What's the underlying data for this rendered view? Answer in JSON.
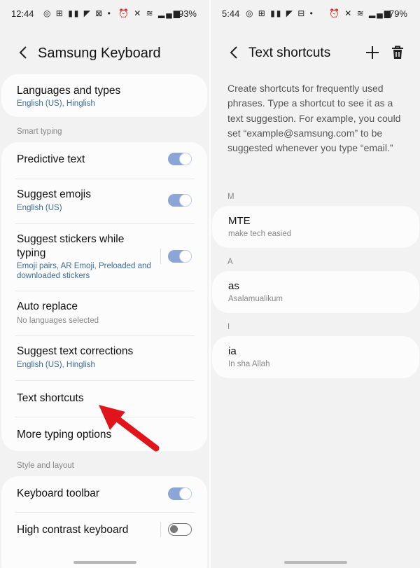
{
  "left": {
    "status": {
      "time": "12:44",
      "battery": "93%"
    },
    "header": {
      "title": "Samsung Keyboard"
    },
    "languages": {
      "label": "Languages and types",
      "value": "English (US), Hinglish"
    },
    "smart_typing": {
      "section_label": "Smart typing",
      "items": [
        {
          "label": "Predictive text",
          "toggle": true
        },
        {
          "label": "Suggest emojis",
          "sub": "English (US)",
          "toggle": true
        },
        {
          "label": "Suggest stickers while typing",
          "sub": "Emoji pairs, AR Emoji, Preloaded and downloaded stickers",
          "toggle": true
        },
        {
          "label": "Auto replace",
          "sub": "No languages selected"
        },
        {
          "label": "Suggest text corrections",
          "sub": "English (US), Hinglish"
        },
        {
          "label": "Text shortcuts"
        },
        {
          "label": "More typing options"
        }
      ]
    },
    "style_layout": {
      "section_label": "Style and layout",
      "items": [
        {
          "label": "Keyboard toolbar",
          "toggle": true
        },
        {
          "label": "High contrast keyboard",
          "toggle": false
        }
      ]
    }
  },
  "right": {
    "status": {
      "time": "5:44",
      "battery": "79%"
    },
    "header": {
      "title": "Text shortcuts"
    },
    "description": "Create shortcuts for frequently used phrases. Type a shortcut to see it as a text suggestion. For example, you could set “example@samsung.com” to be suggested whenever you type “email.”",
    "groups": [
      {
        "letter": "M",
        "shortcut": "MTE",
        "phrase": "make tech easied"
      },
      {
        "letter": "A",
        "shortcut": "as",
        "phrase": "Asalamualikum"
      },
      {
        "letter": "I",
        "shortcut": "ia",
        "phrase": "In sha Allah"
      }
    ]
  },
  "colors": {
    "accent": "#8aa5d6",
    "subtext_blue": "#3a6c9c",
    "annotation_arrow": "#e0151b"
  }
}
